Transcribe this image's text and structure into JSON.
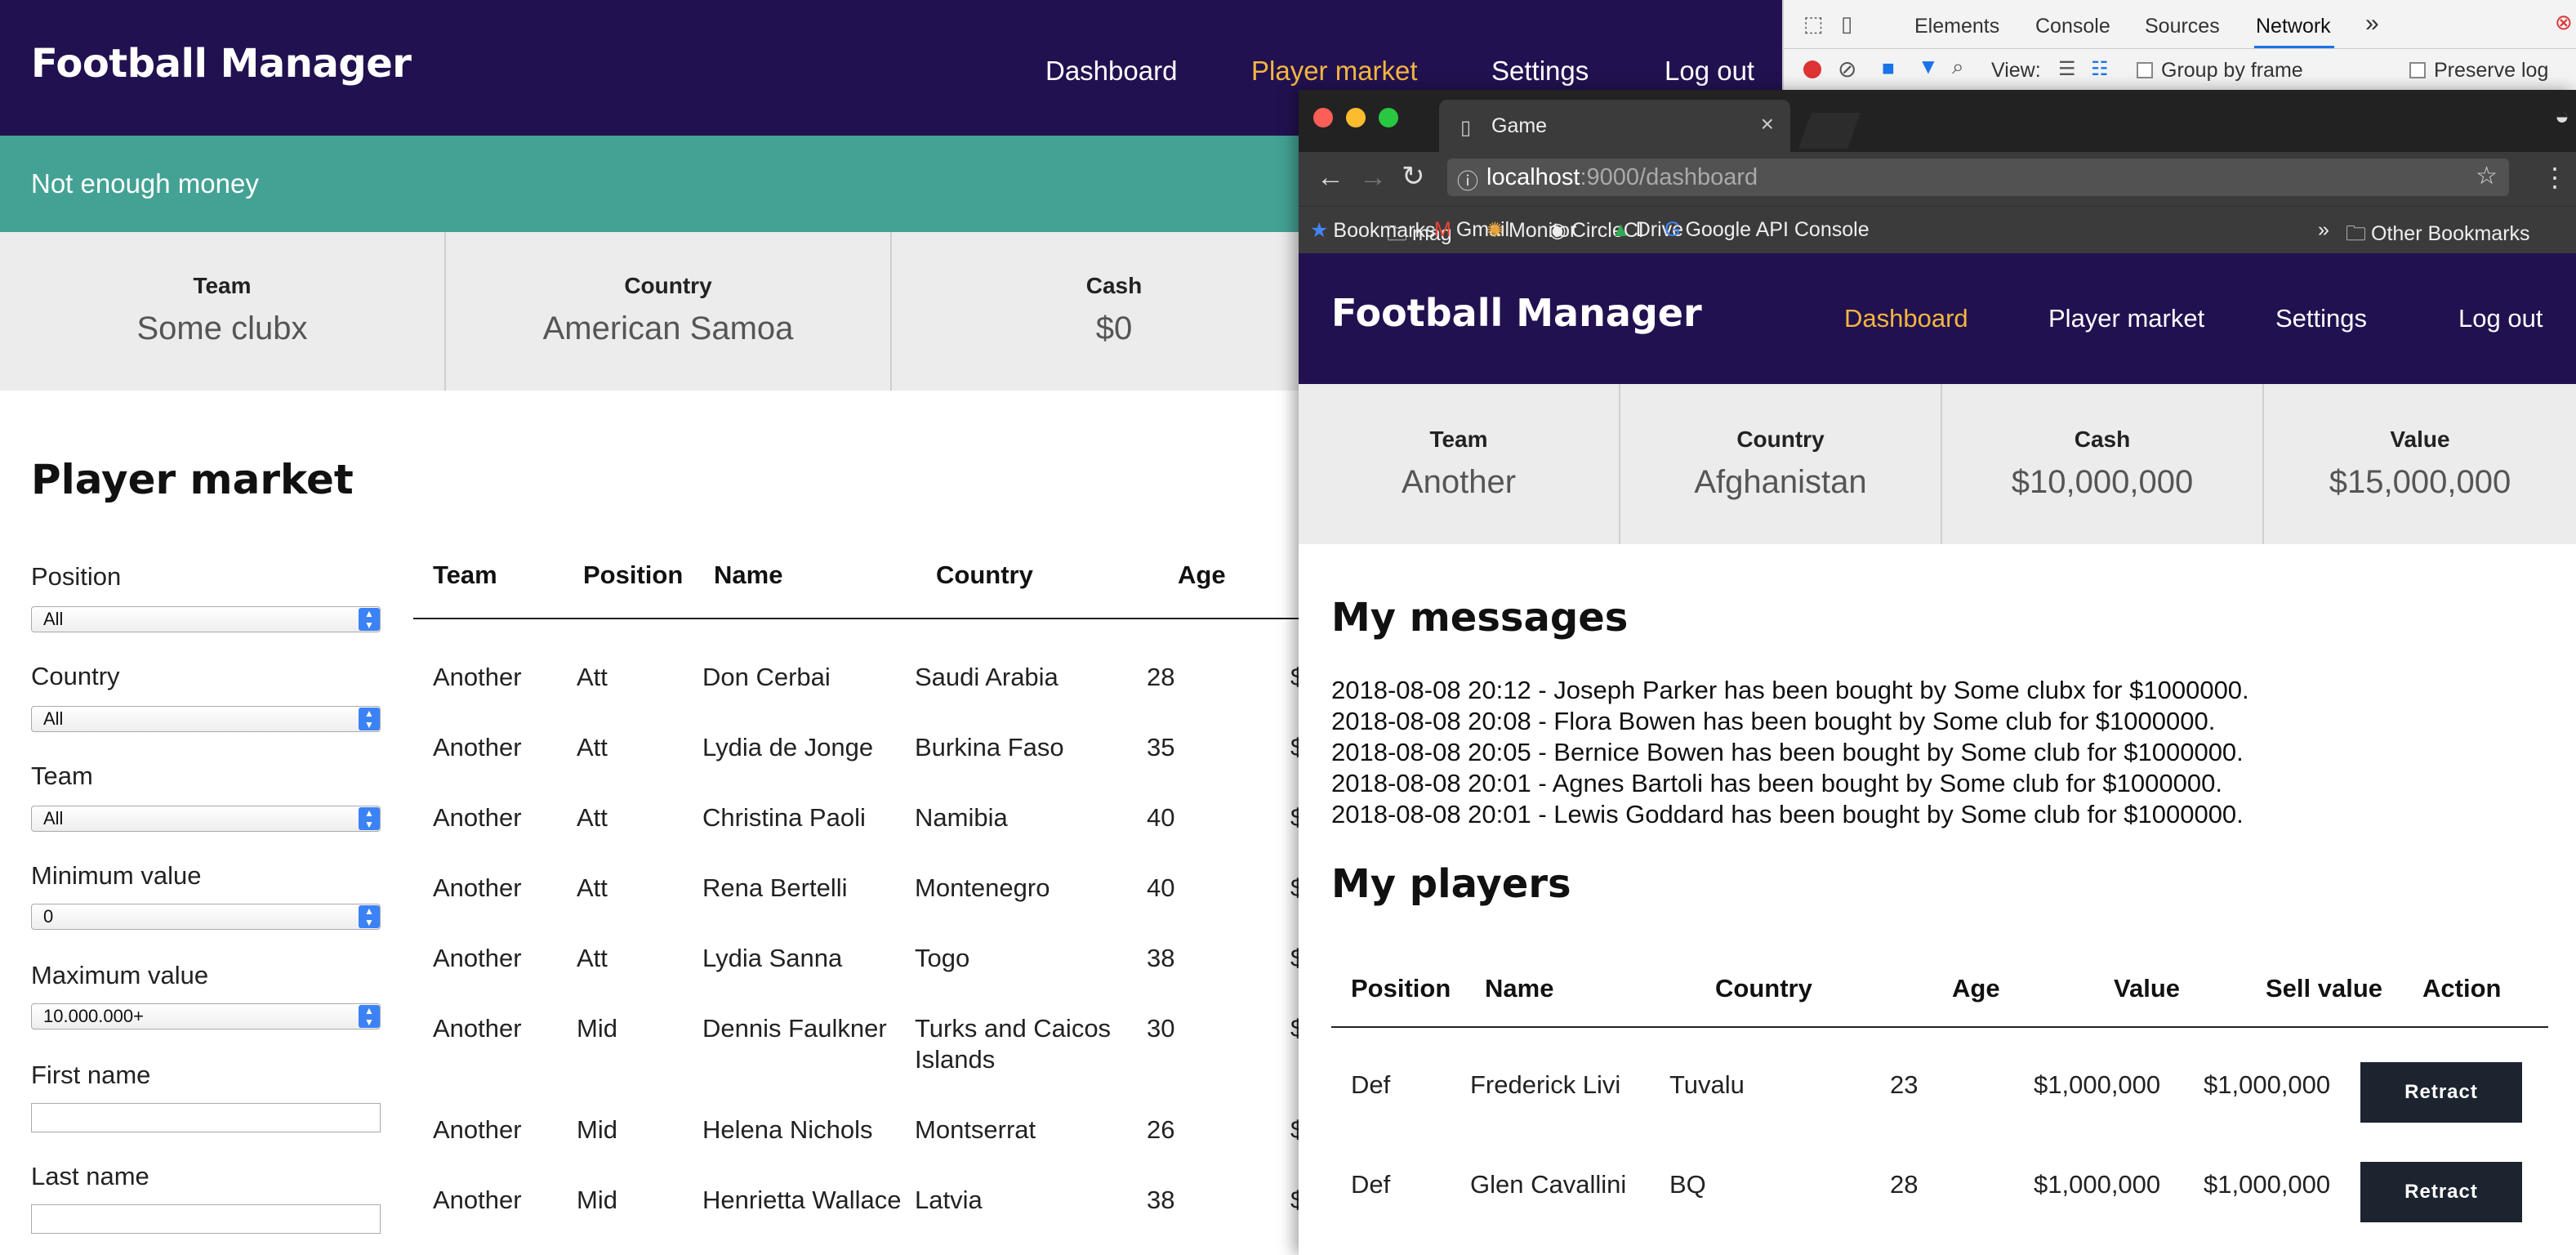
{
  "back": {
    "brand": "Football Manager",
    "nav": [
      "Dashboard",
      "Player market",
      "Settings",
      "Log out"
    ],
    "notice": "Not enough money",
    "stats": [
      {
        "label": "Team",
        "value": "Some clubx"
      },
      {
        "label": "Country",
        "value": "American Samoa"
      },
      {
        "label": "Cash",
        "value": "$0"
      }
    ],
    "title": "Player market",
    "filters": {
      "position_label": "Position",
      "position_value": "All",
      "country_label": "Country",
      "country_value": "All",
      "team_label": "Team",
      "team_value": "All",
      "min_label": "Minimum value",
      "min_value": "0",
      "max_label": "Maximum value",
      "max_value": "10.000.000+",
      "first_label": "First name",
      "last_label": "Last name"
    },
    "columns": [
      "Team",
      "Position",
      "Name",
      "Country",
      "Age"
    ],
    "rows": [
      [
        "Another",
        "Att",
        "Don Cerbai",
        "Saudi Arabia",
        "28"
      ],
      [
        "Another",
        "Att",
        "Lydia de Jonge",
        "Burkina Faso",
        "35"
      ],
      [
        "Another",
        "Att",
        "Christina Paoli",
        "Namibia",
        "40"
      ],
      [
        "Another",
        "Att",
        "Rena Bertelli",
        "Montenegro",
        "40"
      ],
      [
        "Another",
        "Att",
        "Lydia Sanna",
        "Togo",
        "38"
      ],
      [
        "Another",
        "Mid",
        "Dennis Faulkner",
        "Turks and Caicos Islands",
        "30"
      ],
      [
        "Another",
        "Mid",
        "Helena Nichols",
        "Montserrat",
        "26"
      ],
      [
        "Another",
        "Mid",
        "Henrietta Wallace",
        "Latvia",
        "38"
      ]
    ],
    "cut_value_glyph": "$"
  },
  "devtools": {
    "tabs": [
      "Elements",
      "Console",
      "Sources",
      "Network"
    ],
    "active_tab": "Network",
    "more": "»",
    "view_label": "View:",
    "group_by_frame": "Group by frame",
    "preserve_log": "Preserve log"
  },
  "browser": {
    "tab_title": "Game",
    "url_host": "localhost",
    "url_rest": ":9000/dashboard",
    "bookmarks": [
      "Bookmarks",
      "mag",
      "Gmail",
      "Monitor",
      "CircleCI",
      "Drive",
      "Google API Console"
    ],
    "bookmarks_more": "»",
    "other_bookmarks": "Other Bookmarks"
  },
  "front": {
    "brand": "Football Manager",
    "nav": [
      "Dashboard",
      "Player market",
      "Settings",
      "Log out"
    ],
    "stats": [
      {
        "label": "Team",
        "value": "Another"
      },
      {
        "label": "Country",
        "value": "Afghanistan"
      },
      {
        "label": "Cash",
        "value": "$10,000,000"
      },
      {
        "label": "Value",
        "value": "$15,000,000"
      }
    ],
    "messages_title": "My messages",
    "messages": [
      "2018-08-08 20:12 - Joseph Parker has been bought by Some clubx for $1000000.",
      "2018-08-08 20:08 - Flora Bowen has been bought by Some club for $1000000.",
      "2018-08-08 20:05 - Bernice Bowen has been bought by Some club for $1000000.",
      "2018-08-08 20:01 - Agnes Bartoli has been bought by Some club for $1000000.",
      "2018-08-08 20:01 - Lewis Goddard has been bought by Some club for $1000000."
    ],
    "players_title": "My players",
    "player_columns": [
      "Position",
      "Name",
      "Country",
      "Age",
      "Value",
      "Sell value",
      "Action"
    ],
    "players": [
      [
        "Def",
        "Frederick Livi",
        "Tuvalu",
        "23",
        "$1,000,000",
        "$1,000,000",
        "Retract"
      ],
      [
        "Def",
        "Glen Cavallini",
        "BQ",
        "28",
        "$1,000,000",
        "$1,000,000",
        "Retract"
      ]
    ]
  },
  "colors": {
    "nav_bg": "#221150",
    "nav_active": "#f4b63f",
    "notice_bg": "#43a294",
    "stats_bg": "#ececec",
    "button_bg": "#1c2430"
  }
}
